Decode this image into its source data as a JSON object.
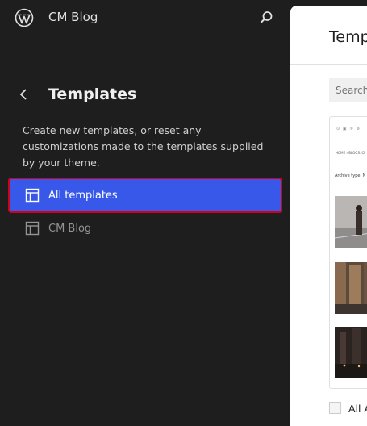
{
  "header": {
    "site_name": "CM Blog",
    "logo_icon": "wordpress-logo-icon",
    "search_icon": "search-icon"
  },
  "panel": {
    "back_icon": "chevron-left-icon",
    "title": "Templates",
    "description": "Create new templates, or reset any customizations made to the templates supplied by your theme.",
    "items": [
      {
        "label": "All templates",
        "icon": "layout-icon",
        "active": true
      },
      {
        "label": "CM Blog",
        "icon": "layout-icon",
        "active": false
      }
    ]
  },
  "main": {
    "title": "Templ",
    "search_placeholder": "Search",
    "preview": {
      "breadcrumb": "HOME › BLOGS: CI",
      "archive_label": "Archive type: N"
    },
    "select_all_label": "All A"
  },
  "colors": {
    "sidebar_bg": "#1e1e1e",
    "active_item_bg": "#3858e9",
    "highlight_border": "#d0021b",
    "main_bg": "#ffffff"
  }
}
